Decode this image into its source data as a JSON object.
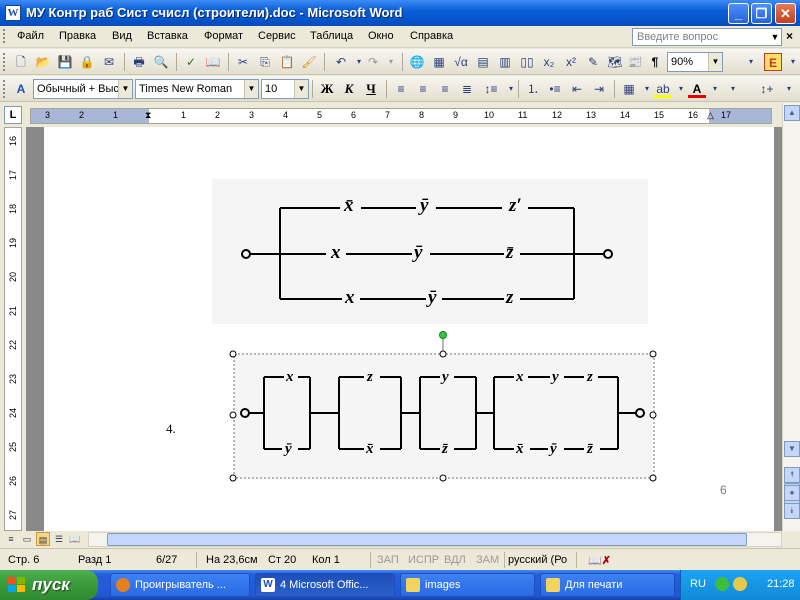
{
  "window": {
    "title": "МУ Контр раб Сист счисл (строители).doc - Microsoft Word",
    "app_icon": "W",
    "buttons": {
      "minimize": "_",
      "maximize": "❐",
      "close": "✕"
    }
  },
  "menu": {
    "items": [
      {
        "label": "Файл"
      },
      {
        "label": "Правка"
      },
      {
        "label": "Вид"
      },
      {
        "label": "Вставка"
      },
      {
        "label": "Формат"
      },
      {
        "label": "Сервис"
      },
      {
        "label": "Таблица"
      },
      {
        "label": "Окно"
      },
      {
        "label": "Справка"
      }
    ],
    "ask_placeholder": "Введите вопрос",
    "close_glyph": "×"
  },
  "toolbar_standard": {
    "zoom": "90%",
    "help_icon": "E"
  },
  "toolbar_formatting": {
    "style": "Обычный + Выс",
    "font": "Times New Roman",
    "size": "10",
    "bold": "Ж",
    "italic": "К",
    "underline": "Ч"
  },
  "ruler": {
    "horizontal": [
      "3",
      "2",
      "1",
      "1",
      "2",
      "3",
      "4",
      "5",
      "6",
      "7",
      "8",
      "9",
      "10",
      "11",
      "12",
      "13",
      "14",
      "15",
      "16",
      "17"
    ],
    "vertical": [
      "16",
      "17",
      "18",
      "19",
      "20",
      "21",
      "22",
      "23",
      "24",
      "25",
      "26",
      "27"
    ]
  },
  "document": {
    "circuit1_labels": {
      "top": [
        "x̄",
        "ȳ",
        "z′"
      ],
      "mid": [
        "x",
        "ȳ",
        "z̄"
      ],
      "bot": [
        "x",
        "ȳ",
        "z"
      ]
    },
    "circuit2_labels": {
      "block1": [
        "x",
        "ȳ"
      ],
      "block2": [
        "z",
        "x̄"
      ],
      "block3": [
        "y",
        "z̄"
      ],
      "block4_top": [
        "x",
        "y",
        "z"
      ],
      "block4_bot": [
        "x̄",
        "ȳ",
        "z̄"
      ]
    },
    "list_number": "4.",
    "page_number": "6"
  },
  "status": {
    "page": "Стр.  6",
    "section": "Разд  1",
    "pages": "6/27",
    "at": "На  23,6см",
    "line": "Ст  20",
    "col": "Кол  1",
    "rec": "ЗАП",
    "trk": "ИСПР",
    "ext": "ВДЛ",
    "ovr": "ЗАМ",
    "language": "русский (Ро"
  },
  "taskbar": {
    "start": "пуск",
    "tasks": [
      {
        "label": "Проигрыватель ...",
        "icon": "player-icon"
      },
      {
        "label": "4 Microsoft Offic...",
        "icon": "word-icon"
      },
      {
        "label": "images",
        "icon": "folder-icon"
      },
      {
        "label": "Для печати",
        "icon": "folder-icon"
      }
    ],
    "language": "RU",
    "clock": "21:28"
  },
  "colors": {
    "titlebar": "#0a5fd8",
    "taskbar": "#245edb",
    "start": "#3a9a3a",
    "tray": "#108ad8"
  }
}
